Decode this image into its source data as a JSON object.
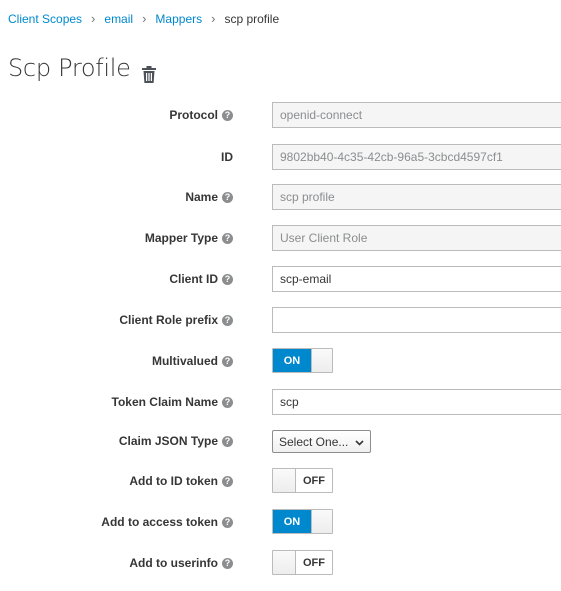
{
  "breadcrumb": {
    "items": [
      "Client Scopes",
      "email",
      "Mappers"
    ],
    "current": "scp profile",
    "separator": "›"
  },
  "title": "Scp Profile",
  "icons": {
    "delete": "trash-icon",
    "help": "question-circle-icon",
    "select": "chevron-down-icon"
  },
  "colors": {
    "link": "#0088ce",
    "toggle_on": "#0088ce",
    "readonly_bg": "#f5f5f5"
  },
  "form": {
    "protocol": {
      "label": "Protocol",
      "value": "openid-connect"
    },
    "id": {
      "label": "ID",
      "value": "9802bb40-4c35-42cb-96a5-3cbcd4597cf1"
    },
    "name": {
      "label": "Name",
      "value": "scp profile"
    },
    "mapper_type": {
      "label": "Mapper Type",
      "value": "User Client Role"
    },
    "client_id": {
      "label": "Client ID",
      "value": "scp-email"
    },
    "client_role_prefix": {
      "label": "Client Role prefix",
      "value": ""
    },
    "multivalued": {
      "label": "Multivalued",
      "state": "ON"
    },
    "token_claim_name": {
      "label": "Token Claim Name",
      "value": "scp"
    },
    "claim_json_type": {
      "label": "Claim JSON Type",
      "value": "Select One..."
    },
    "add_to_id_token": {
      "label": "Add to ID token",
      "state": "OFF"
    },
    "add_to_access_token": {
      "label": "Add to access token",
      "state": "ON"
    },
    "add_to_userinfo": {
      "label": "Add to userinfo",
      "state": "OFF"
    }
  }
}
